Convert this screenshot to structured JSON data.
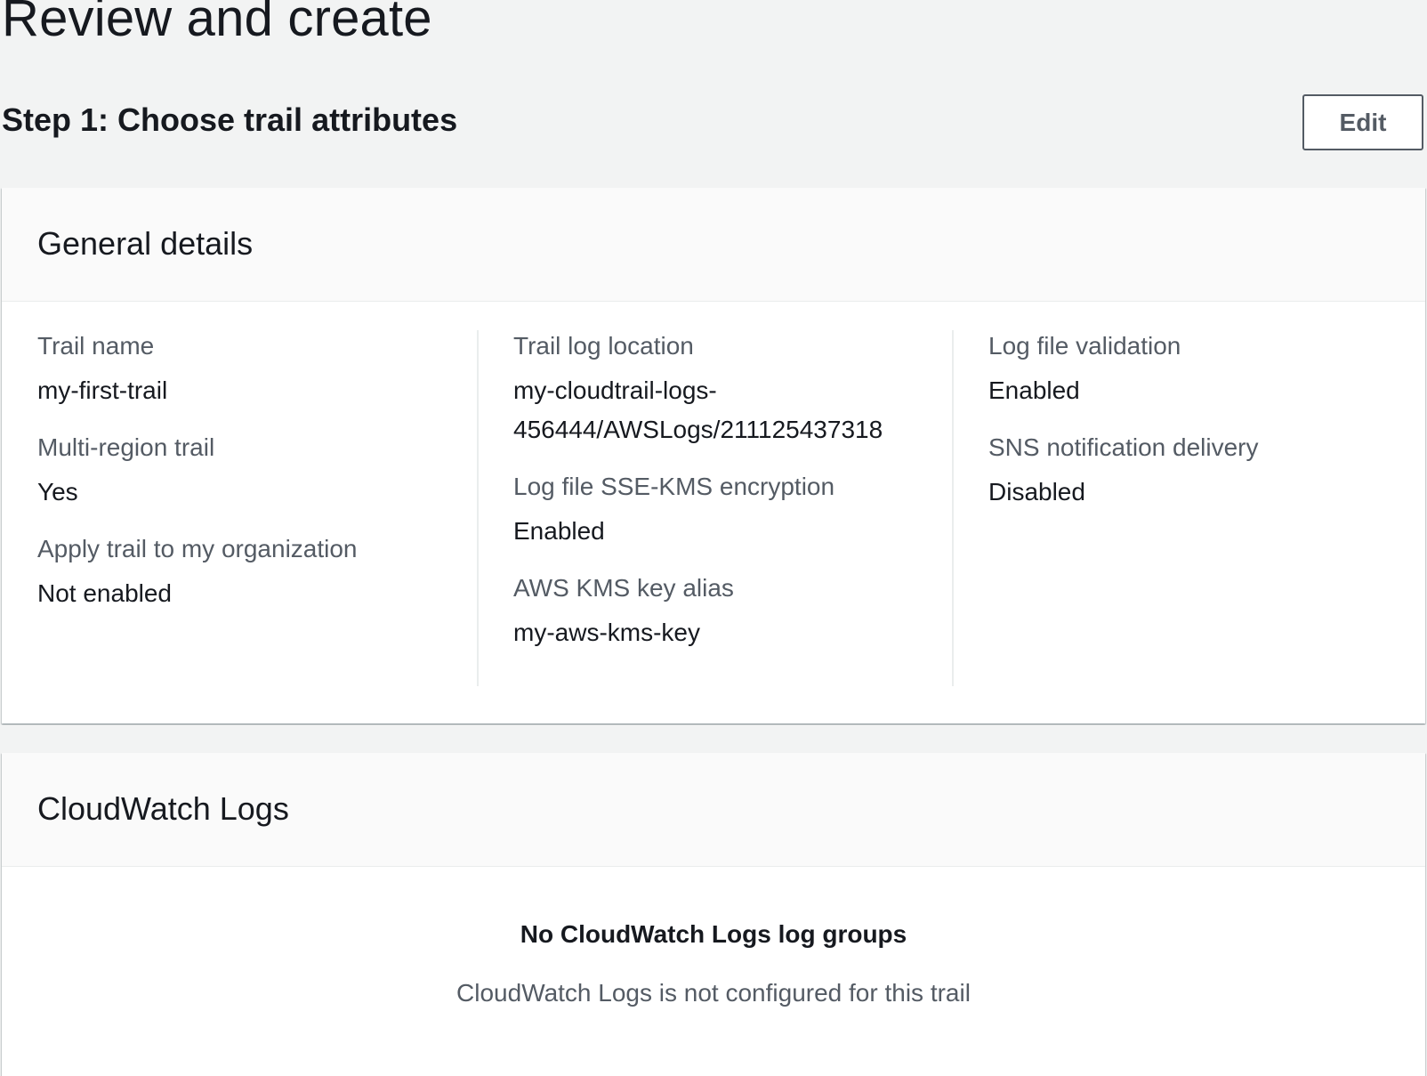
{
  "page": {
    "title": "Review and create"
  },
  "step": {
    "title": "Step 1: Choose trail attributes",
    "edit_label": "Edit"
  },
  "general_details": {
    "header": "General details",
    "trail_name": {
      "label": "Trail name",
      "value": "my-first-trail"
    },
    "multi_region": {
      "label": "Multi-region trail",
      "value": "Yes"
    },
    "apply_org": {
      "label": "Apply trail to my organization",
      "value": "Not enabled"
    },
    "log_location": {
      "label": "Trail log location",
      "value_line1": "my-cloudtrail-logs-",
      "value_line2": "456444/AWSLogs/211125437318"
    },
    "sse_kms": {
      "label": "Log file SSE-KMS encryption",
      "value": "Enabled"
    },
    "kms_alias": {
      "label": "AWS KMS key alias",
      "value": "my-aws-kms-key"
    },
    "log_validation": {
      "label": "Log file validation",
      "value": "Enabled"
    },
    "sns_delivery": {
      "label": "SNS notification delivery",
      "value": "Disabled"
    }
  },
  "cloudwatch": {
    "header": "CloudWatch Logs",
    "empty_title": "No CloudWatch Logs log groups",
    "empty_desc": "CloudWatch Logs is not configured for this trail"
  }
}
